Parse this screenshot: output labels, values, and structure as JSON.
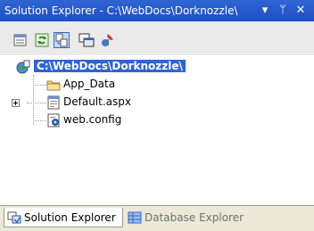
{
  "window": {
    "title": "Solution Explorer - C:\\WebDocs\\Dorknozzle\\",
    "dropdown_glyph": "▾",
    "pin_glyph": "ᛘ",
    "close_glyph": "✕"
  },
  "toolbar": {
    "buttons": [
      {
        "name": "properties-icon",
        "selected": false
      },
      {
        "name": "refresh-icon",
        "selected": false
      },
      {
        "name": "nest-related-files-icon",
        "selected": true
      },
      {
        "name": "copy-web-site-icon",
        "selected": false
      },
      {
        "name": "asp-net-configuration-icon",
        "selected": false
      }
    ]
  },
  "tree": {
    "root": {
      "label": "C:\\WebDocs\\Dorknozzle\\",
      "icon": "web-project-icon",
      "selected": true
    },
    "items": [
      {
        "label": "App_Data",
        "icon": "folder-icon",
        "expandable": false
      },
      {
        "label": "Default.aspx",
        "icon": "aspx-file-icon",
        "expandable": true
      },
      {
        "label": "web.config",
        "icon": "config-file-icon",
        "expandable": false
      }
    ]
  },
  "tabs": [
    {
      "label": "Solution Explorer",
      "icon": "solution-explorer-icon",
      "active": true
    },
    {
      "label": "Database Explorer",
      "icon": "database-explorer-icon",
      "active": false
    }
  ],
  "colors": {
    "titlebar": "#2f64d3",
    "selection": "#2f64d3",
    "toolbar_bg": "#eaeaea",
    "tab_bg": "#ece9d8"
  }
}
